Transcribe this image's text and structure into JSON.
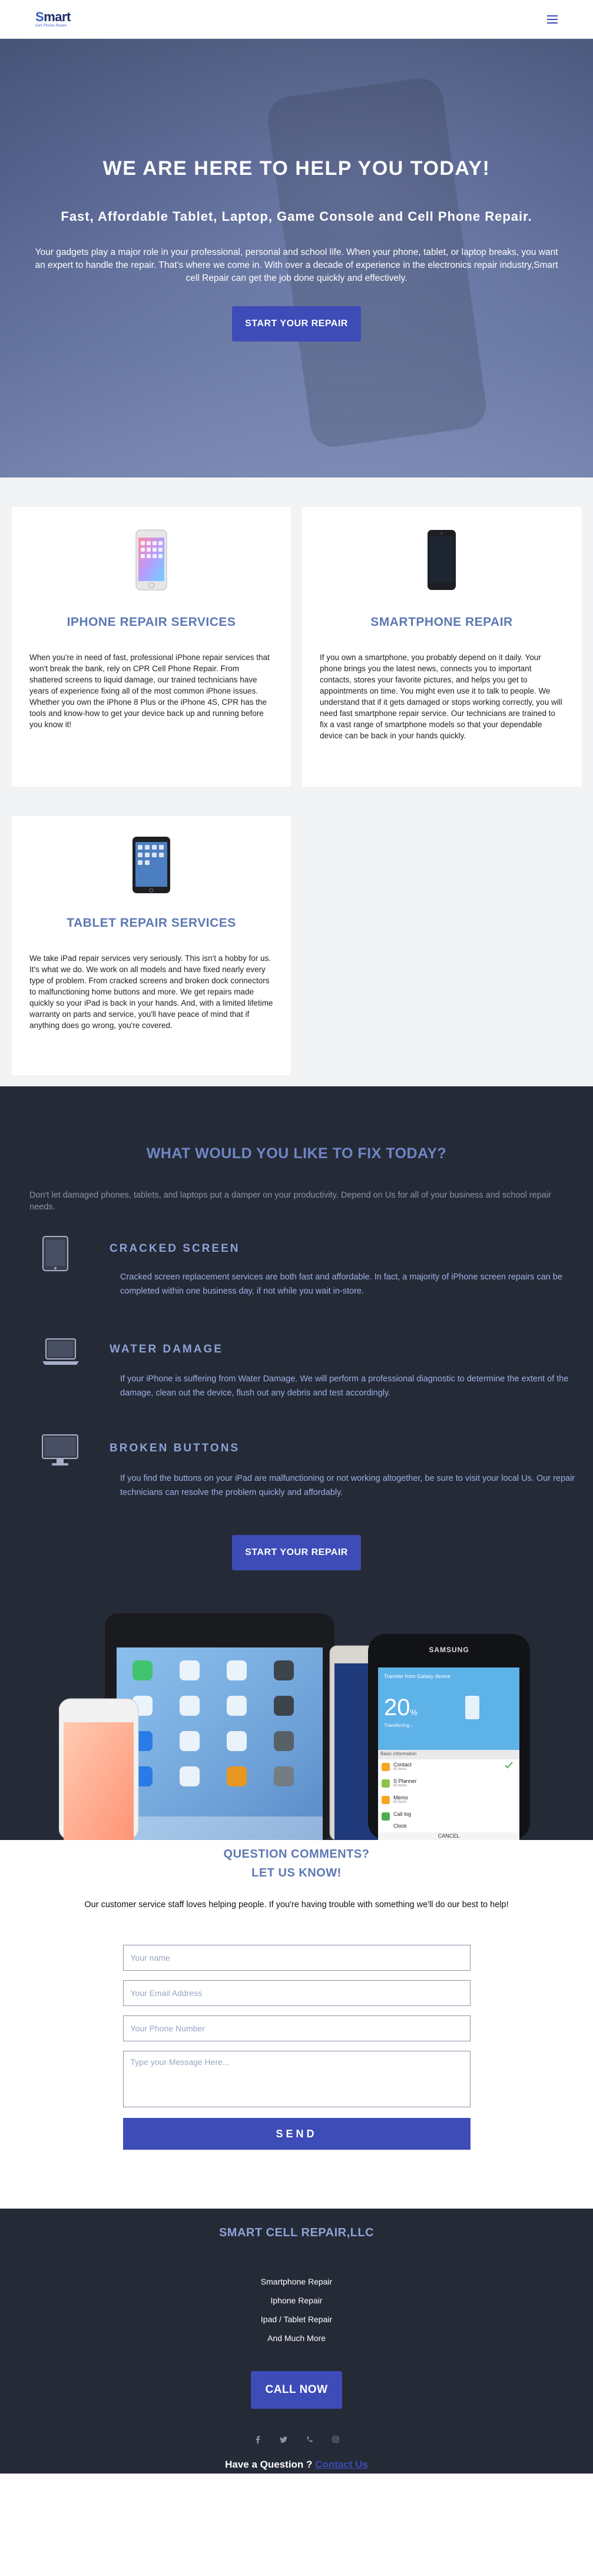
{
  "header": {
    "logo_main": "mart",
    "logo_initial": "S",
    "logo_sub": "Cell Phone Repair",
    "menu_icon": "hamburger-menu-icon"
  },
  "hero": {
    "title": "WE ARE HERE TO HELP YOU TODAY!",
    "subtitle": "Fast, Affordable Tablet, Laptop, Game Console and Cell Phone Repair.",
    "text": "Your gadgets play a major role in your professional, personal and school life. When your phone, tablet, or laptop breaks, you want an expert to handle the repair. That's where we come in. With over a decade of experience in the electronics repair industry,Smart cell Repair can get the job done quickly and effectively.",
    "button": "START YOUR REPAIR"
  },
  "services": [
    {
      "title": "IPHONE REPAIR SERVICES",
      "icon": "iphone-icon",
      "text": "When you're in need of fast, professional iPhone repair services that won't break the bank, rely on CPR Cell Phone Repair. From shattered screens to liquid damage, our trained technicians have years of experience fixing all of the most common iPhone issues. Whether you own the iPhone 8 Plus or the iPhone 4S, CPR has the tools and know-how to get your device back up and running before you know it!"
    },
    {
      "title": "SMARTPHONE REPAIR",
      "icon": "smartphone-icon",
      "text": "If you own a smartphone, you probably depend on it daily. Your phone brings you the latest news, connects you to important contacts, stores your favorite pictures, and helps you get to appointments on time. You might even use it to talk to people. We understand that if it gets damaged or stops working correctly, you will need fast smartphone repair service. Our technicians are trained to fix a vast range of smartphone models so that your dependable device can be back in your hands quickly."
    },
    {
      "title": "TABLET REPAIR SERVICES",
      "icon": "tablet-icon",
      "text": "We take iPad repair services very seriously. This isn't a hobby for us. It's what we do. We work on all models and have fixed nearly every type of problem. From cracked screens and broken dock connectors to malfunctioning home buttons and more. We get repairs made quickly so your iPad is back in your hands. And, with a limited lifetime warranty on parts and service, you'll have peace of mind that if anything does go wrong, you're covered."
    }
  ],
  "fix": {
    "title": "WHAT WOULD YOU LIKE TO FIX TODAY?",
    "intro": "Don't let damaged phones, tablets, and laptops put a damper on your productivity. Depend on Us for all of your business and school repair needs.",
    "items": [
      {
        "title": "CRACKED SCREEN",
        "icon": "tablet-outline-icon",
        "text": "Cracked screen replacement services are both fast and affordable. In fact, a majority of iPhone screen repairs can be completed within one business day, if not while you wait in-store."
      },
      {
        "title": "WATER DAMAGE",
        "icon": "laptop-outline-icon",
        "text": "If your iPhone is suffering from Water Damage. We will perform a professional diagnostic to determine the extent of the damage, clean out the device, flush out any debris and test accordingly."
      },
      {
        "title": "BROKEN BUTTONS",
        "icon": "monitor-outline-icon",
        "text": "If you find the buttons on your iPad are malfunctioning or not working altogether, be sure to visit your local Us. Our repair technicians can resolve the problem quickly and affordably."
      }
    ],
    "button": "START YOUR REPAIR",
    "devices_image": {
      "samsung_brand": "SAMSUNG",
      "transfer_text": "Transfer from Galaxy device",
      "percent": "20",
      "percent_unit": "%",
      "transferring": "Transferring...",
      "basic_info": "Basic information",
      "list": [
        {
          "label": "Contact",
          "sub": "80 items"
        },
        {
          "label": "S Planner",
          "sub": "80 items"
        },
        {
          "label": "Memo",
          "sub": "80 items"
        },
        {
          "label": "Call log",
          "sub": ""
        },
        {
          "label": "Clock",
          "sub": ""
        }
      ],
      "cancel": "CANCEL"
    }
  },
  "contact": {
    "title_line1": "QUESTION COMMENTS?",
    "title_line2": "LET US KNOW!",
    "lead": "Our customer service staff loves helping people. If you're having trouble with something we'll do our best to help!",
    "name_placeholder": "Your name",
    "email_placeholder": "Your Email Address",
    "phone_placeholder": "Your Phone Number",
    "message_placeholder": "Type your Message Here...",
    "send": "SEND"
  },
  "footer": {
    "title": "SMART CELL REPAIR,LLC",
    "links": [
      "Smartphone Repair",
      "Iphone Repair",
      "Ipad / Tablet Repair",
      "And Much More"
    ],
    "call_button": "CALL NOW",
    "social_icons": [
      "facebook-icon",
      "twitter-icon",
      "phone-icon",
      "instagram-icon"
    ],
    "question_text": "Have a Question ?",
    "question_link": "Contact Us"
  },
  "colors": {
    "accent": "#3d4cb7",
    "heading_blue": "#5d78b3",
    "dark_bg": "#252a37"
  }
}
